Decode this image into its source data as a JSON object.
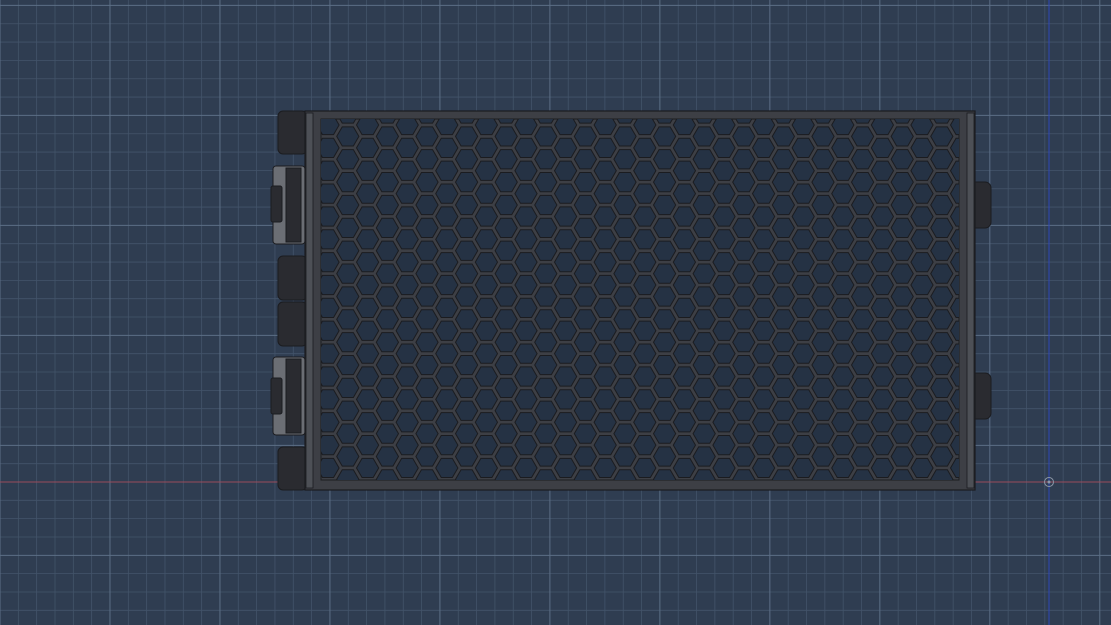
{
  "viewport": {
    "background": "#2f3d51",
    "grid": {
      "shown": true,
      "minor_color": "#43546a",
      "major_color": "#5c6f86"
    },
    "axes": {
      "x_axis_color": "#9a4b5b",
      "y_axis_color": "#2e47b8"
    },
    "origin_marker_icon": "origin-gizmo-icon"
  },
  "model": {
    "part": "honeycomb-grille-panel",
    "frame_color": "#3d3f45",
    "hex_fill_color": "#253244",
    "edge_color": "#1b1c20",
    "left_rail_color": "#4d5056",
    "bracket_color": "#6b6e74",
    "clip_color": "#2a2b30"
  }
}
